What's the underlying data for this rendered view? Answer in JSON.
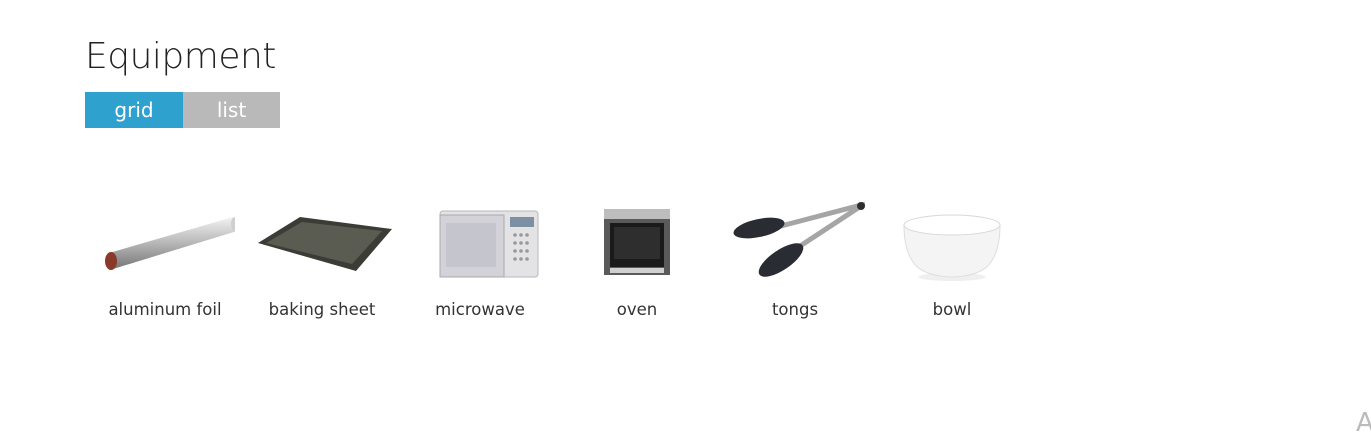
{
  "page": {
    "title": "Equipment"
  },
  "view_toggle": {
    "grid": "grid",
    "list": "list"
  },
  "equipment": [
    {
      "label": "aluminum foil",
      "icon": "aluminum-foil-icon"
    },
    {
      "label": "baking sheet",
      "icon": "baking-sheet-icon"
    },
    {
      "label": "microwave",
      "icon": "microwave-icon"
    },
    {
      "label": "oven",
      "icon": "oven-icon"
    },
    {
      "label": "tongs",
      "icon": "tongs-icon"
    },
    {
      "label": "bowl",
      "icon": "bowl-icon"
    }
  ],
  "corner_glyph": "A",
  "colors": {
    "accent": "#2ea1cf",
    "inactive": "#b9b9b9"
  }
}
